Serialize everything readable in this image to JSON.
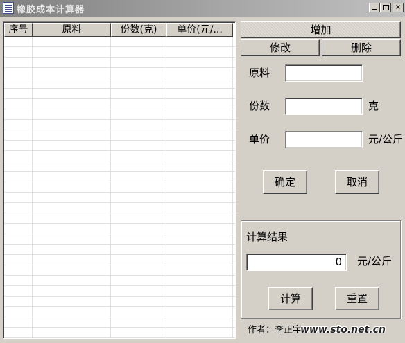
{
  "window": {
    "title": "橡胶成本计算器",
    "minimize": "_",
    "maximize": "□",
    "close": "×"
  },
  "table": {
    "columns": [
      "序号",
      "原料",
      "份数(克)",
      "单价(元/..."
    ],
    "rows": []
  },
  "actions": {
    "add_label": "增加",
    "edit_label": "修改",
    "delete_label": "删除",
    "confirm_label": "确定",
    "cancel_label": "取消"
  },
  "form": {
    "material_label": "原料",
    "material_value": "",
    "quantity_label": "份数",
    "quantity_value": "",
    "quantity_unit": "克",
    "price_label": "单价",
    "price_value": "",
    "price_unit": "元/公斤"
  },
  "result": {
    "group_label": "计算结果",
    "value": "0",
    "unit": "元/公斤",
    "calc_label": "计算",
    "reset_label": "重置"
  },
  "footer": {
    "author_text": "作者：李正宇"
  },
  "watermark": {
    "text": "www.sto.net.cn"
  }
}
